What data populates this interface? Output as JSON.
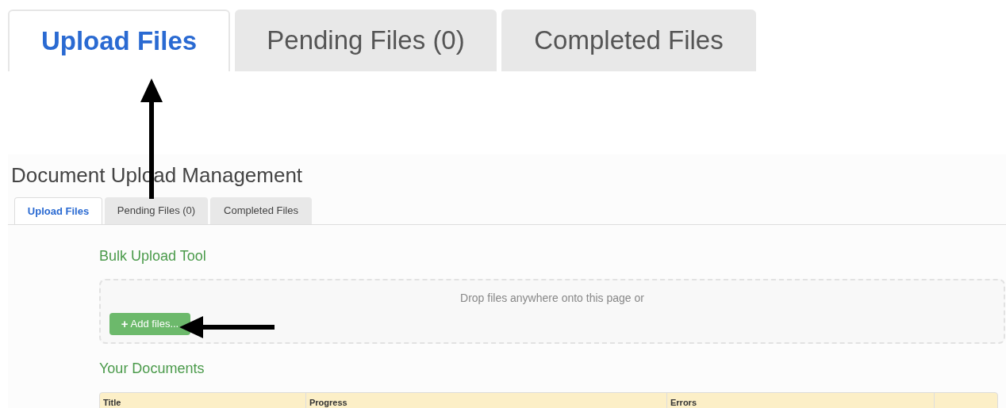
{
  "zoomed_tabs": [
    {
      "label": "Upload Files",
      "selected": true
    },
    {
      "label": "Pending Files (0)",
      "selected": false
    },
    {
      "label": "Completed Files",
      "selected": false
    }
  ],
  "page": {
    "title": "Document Upload Management",
    "tabs": [
      {
        "label": "Upload Files",
        "selected": true
      },
      {
        "label": "Pending Files (0)",
        "selected": false
      },
      {
        "label": "Completed Files",
        "selected": false
      }
    ],
    "bulk_upload": {
      "heading": "Bulk Upload Tool",
      "drop_text": "Drop files anywhere onto this page or",
      "button": {
        "icon": "+",
        "label": "Add files..."
      }
    },
    "documents": {
      "heading": "Your Documents",
      "columns": [
        "Title",
        "Progress",
        "Errors"
      ]
    }
  }
}
